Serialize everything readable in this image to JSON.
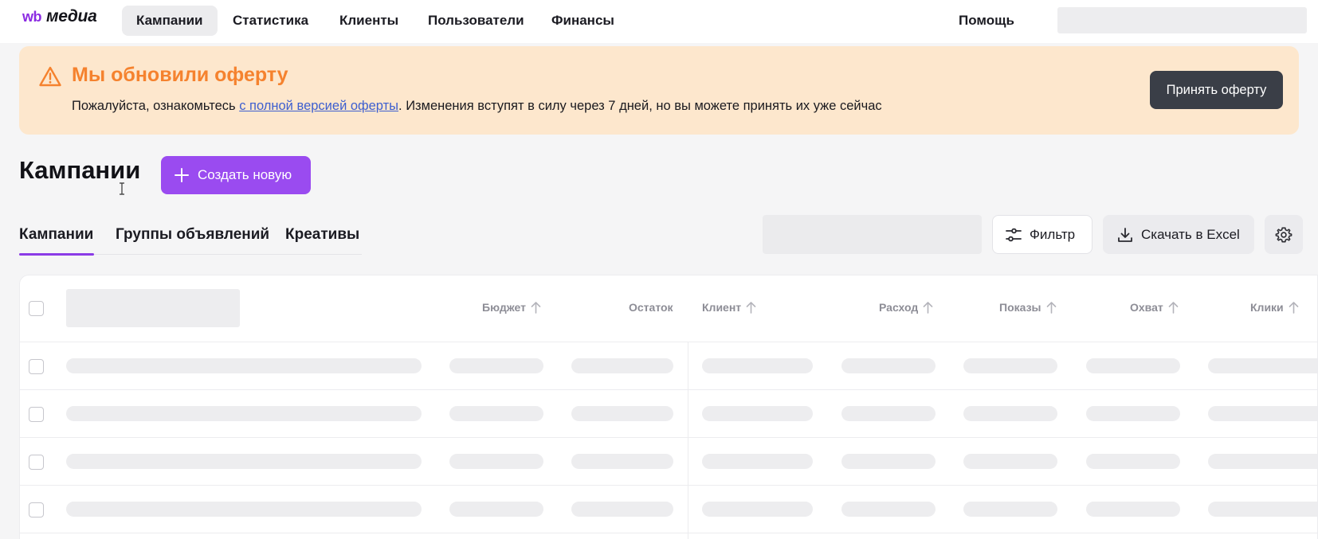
{
  "logo": {
    "wb": "wb",
    "media": "медиа"
  },
  "nav": {
    "items": [
      {
        "label": "Кампании",
        "active": true
      },
      {
        "label": "Статистика",
        "active": false
      },
      {
        "label": "Клиенты",
        "active": false
      },
      {
        "label": "Пользователи",
        "active": false
      },
      {
        "label": "Финансы",
        "active": false
      }
    ],
    "help_label": "Помощь"
  },
  "banner": {
    "icon": "warning-triangle-icon",
    "title": "Мы обновили оферту",
    "text_before_link": "Пожалуйста, ознакомьтесь ",
    "link_text": "с полной версией оферты",
    "text_after_link": ". Изменения вступят в силу через 7 дней, но вы можете принять их уже сейчас",
    "accept_label": "Принять оферту",
    "colors": {
      "background": "#fde7cd",
      "title": "#f5822e"
    }
  },
  "page": {
    "title": "Кампании",
    "create_label": "Создать новую",
    "accent": "#9a4bf0"
  },
  "tabs": [
    {
      "label": "Кампании",
      "active": true
    },
    {
      "label": "Группы объявлений",
      "active": false
    },
    {
      "label": "Креативы",
      "active": false
    }
  ],
  "toolbar": {
    "filter_label": "Фильтр",
    "filter_icon": "sliders-icon",
    "excel_label": "Скачать в Excel",
    "excel_icon": "download-icon",
    "settings_icon": "gear-icon"
  },
  "table": {
    "columns": [
      {
        "label": "Бюджет",
        "sortable": true
      },
      {
        "label": "Остаток",
        "sortable": false
      },
      {
        "label": "Клиент",
        "sortable": true
      },
      {
        "label": "Расход",
        "sortable": true
      },
      {
        "label": "Показы",
        "sortable": true
      },
      {
        "label": "Охват",
        "sortable": true
      },
      {
        "label": "Клики",
        "sortable": true
      }
    ],
    "loading": true,
    "skeleton_rows": 4
  }
}
